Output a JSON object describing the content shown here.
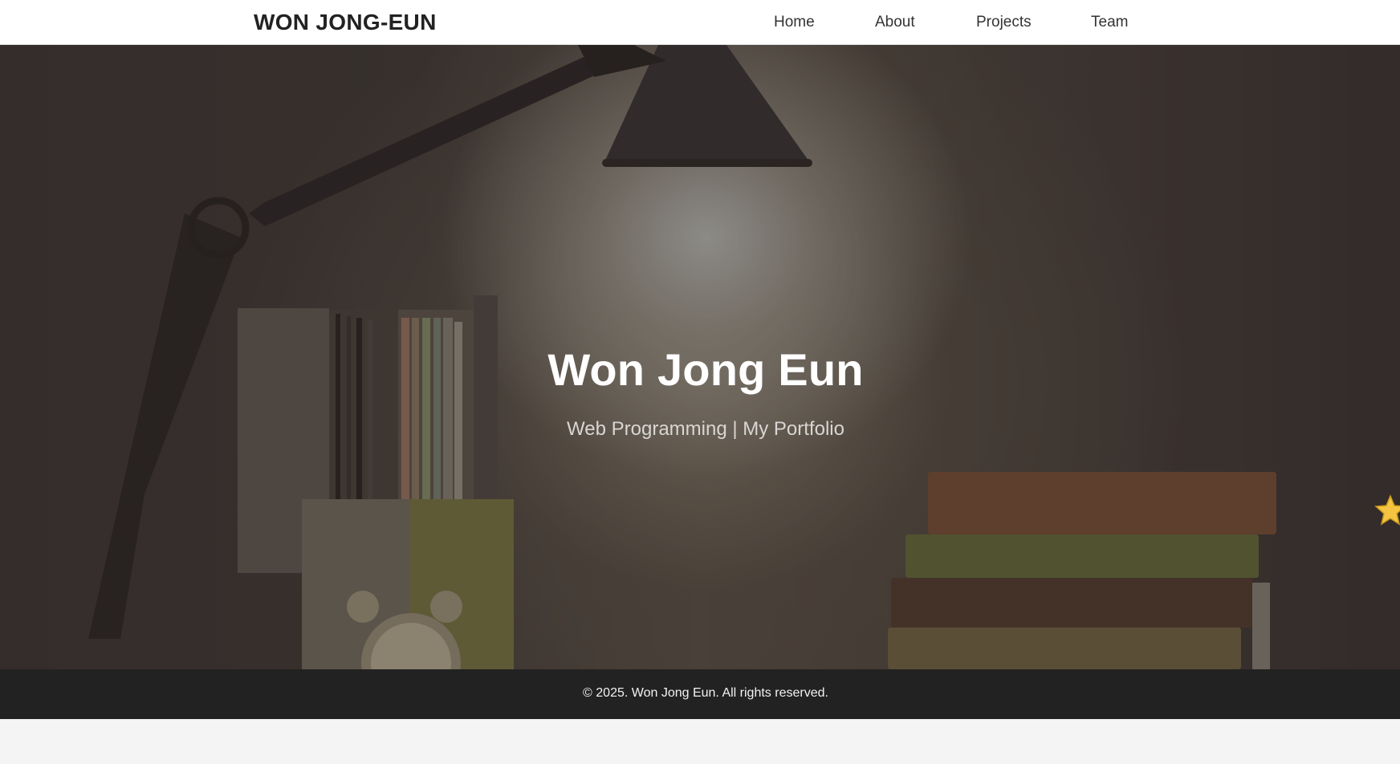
{
  "header": {
    "logo": "WON JONG-EUN",
    "nav": [
      "Home",
      "About",
      "Projects",
      "Team"
    ]
  },
  "hero": {
    "title": "Won Jong Eun",
    "subtitle": "Web Programming | My Portfolio"
  },
  "floating_button": {
    "icon": "star-icon",
    "color": "#f5c542"
  },
  "footer": {
    "copyright": "© 2025. Won Jong Eun. All rights reserved."
  },
  "colors": {
    "header_bg": "#ffffff",
    "footer_bg": "#232222",
    "page_bg": "#f4f4f4"
  }
}
